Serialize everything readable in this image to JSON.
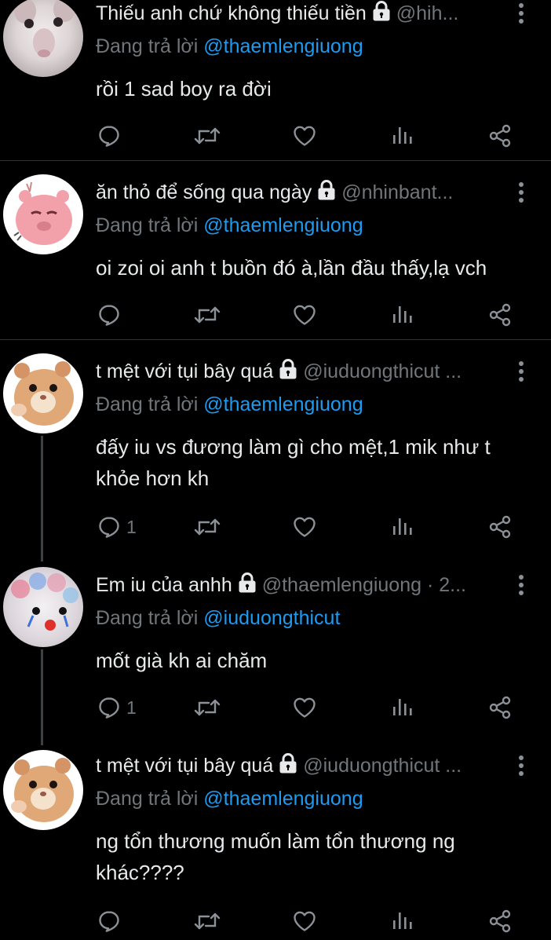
{
  "tweets": [
    {
      "name": "Thiếu anh chứ không thiếu tiền",
      "handle": "@hih...",
      "reply_prefix": "Đang trả lời",
      "reply_to": "@thaemlengiuong",
      "text": "rồi 1 sad boy ra đời",
      "reply_count": "",
      "avatar": "white-rat-avatar"
    },
    {
      "name": "ăn thỏ để sống qua ngày",
      "handle": "@nhinbant...",
      "reply_prefix": "Đang trả lời",
      "reply_to": "@thaemlengiuong",
      "text": "oi zoi oi anh t buồn đó à,lần đầu thấy,lạ vch",
      "reply_count": "",
      "avatar": "pink-bear-avatar"
    },
    {
      "name": "t mệt với tụi bây quá",
      "handle": "@iuduongthicut ...",
      "reply_prefix": "Đang trả lời",
      "reply_to": "@thaemlengiuong",
      "text": "đấy iu vs đương làm gì cho mệt,1 mik như t khỏe hơn kh",
      "reply_count": "1",
      "avatar": "hamster-avatar"
    },
    {
      "name": "Em iu của anhh",
      "handle": "@thaemlengiuong · 2...",
      "reply_prefix": "Đang trả lời",
      "reply_to": "@iuduongthicut",
      "text": "mốt già kh ai chăm",
      "reply_count": "1",
      "avatar": "clown-cat-avatar"
    },
    {
      "name": "t mệt với tụi bây quá",
      "handle": "@iuduongthicut ...",
      "reply_prefix": "Đang trả lời",
      "reply_to": "@thaemlengiuong",
      "text": "ng tổn thương muốn làm tổn thương ng khác????",
      "reply_count": "",
      "avatar": "hamster-avatar"
    }
  ],
  "icons": {
    "reply": "reply-icon",
    "retweet": "retweet-icon",
    "like": "heart-icon",
    "views": "views-icon",
    "share": "share-icon",
    "lock": "lock-icon",
    "more": "more-icon"
  },
  "colors": {
    "background": "#000000",
    "text": "#e7e9ea",
    "muted": "#71767b",
    "mention": "#1d9bf0",
    "divider": "#2f3336"
  }
}
